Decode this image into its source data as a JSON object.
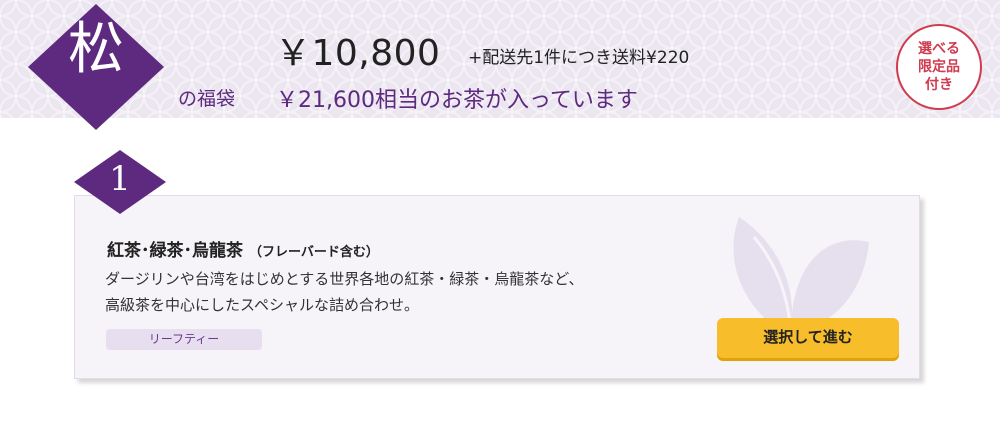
{
  "header": {
    "rank_kanji": "松",
    "label": "の福袋",
    "price": "￥10,800",
    "shipping_note": "+配送先1件につき送料¥220",
    "equivalent_value": "￥21,600相当のお茶が入っています",
    "badge": "選べる\n限定品\n付き"
  },
  "option": {
    "number": "1",
    "title": "紅茶･緑茶･烏龍茶",
    "title_note": "（フレーバード含む）",
    "description_lines": [
      "ダージリンや台湾をはじめとする世界各地の紅茶・緑茶・烏龍茶など、",
      "高級茶を中心にしたスペシャルな詰め合わせ。"
    ],
    "tag": "リーフティー",
    "select_label": "選択して進む"
  },
  "colors": {
    "brand_purple": "#5d2a7f",
    "header_bg": "#ece6f1",
    "badge_red": "#cf3b4f",
    "button_yellow": "#f7bd2a",
    "card_bg": "#f7f4f9"
  },
  "icons": {
    "rank": "diamond-badge",
    "decor": "tea-leaf-icon"
  }
}
